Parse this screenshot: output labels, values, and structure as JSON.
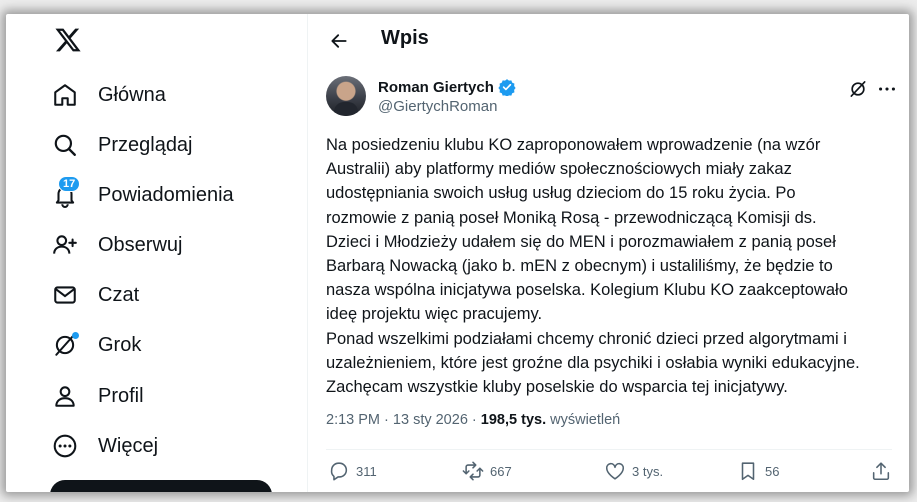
{
  "sidebar": {
    "items": [
      {
        "label": "Główna",
        "icon": "home-icon"
      },
      {
        "label": "Przeglądaj",
        "icon": "search-icon"
      },
      {
        "label": "Powiadomienia",
        "icon": "bell-icon",
        "badge": "17"
      },
      {
        "label": "Obserwuj",
        "icon": "follow-icon"
      },
      {
        "label": "Czat",
        "icon": "mail-icon"
      },
      {
        "label": "Grok",
        "icon": "grok-icon"
      },
      {
        "label": "Profil",
        "icon": "profile-icon"
      },
      {
        "label": "Więcej",
        "icon": "more-circle-icon"
      }
    ]
  },
  "header": {
    "title": "Wpis"
  },
  "post": {
    "author_name": "Roman Giertych",
    "author_handle": "@GiertychRoman",
    "text": "Na posiedzeniu klubu KO zaproponowałem wprowadzenie (na wzór\nAustralii) aby platformy mediów społecznościowych miały zakaz\nudostępniania swoich usług  usług dzieciom do 15 roku życia. Po\nrozmowie z panią poseł Moniką Rosą - przewodniczącą Komisji ds.\nDzieci i Młodzieży udałem się do MEN i porozmawiałem z panią poseł\nBarbarą Nowacką (jako b. mEN z obecnym) i ustaliliśmy, że będzie to\nnasza wspólna inicjatywa poselska. Kolegium Klubu KO zaakceptowało\nideę projektu więc pracujemy.\nPonad wszelkimi podziałami chcemy chronić dzieci przed algorytmami i\nuzależnieniem, które jest groźne dla psychiki i osłabia wyniki edukacyjne.\nZachęcam wszystkie kluby poselskie do wsparcia tej inicjatywy.",
    "time": "2:13 PM",
    "date": "13 sty 2026",
    "separator": "·",
    "views_count": "198,5 tys.",
    "views_label": "wyświetleń",
    "actions": {
      "replies": "311",
      "reposts": "667",
      "likes": "3 tys.",
      "bookmarks": "56"
    }
  },
  "colors": {
    "accent": "#1d9bf0",
    "text": "#0f1419",
    "muted": "#536471"
  }
}
